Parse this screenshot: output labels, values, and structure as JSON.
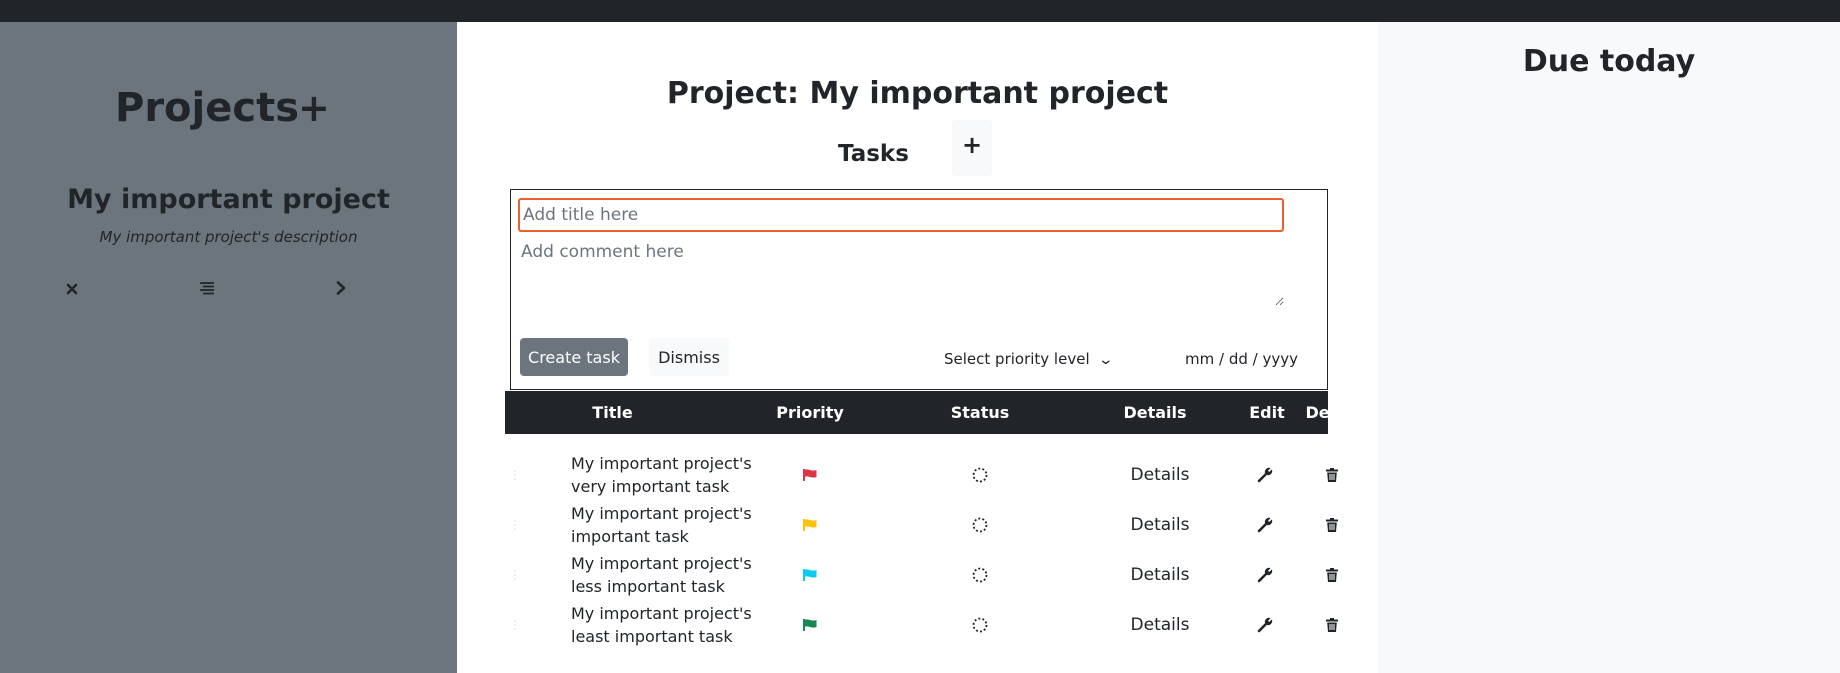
{
  "sidebar": {
    "title": "Projects",
    "add_label": "+",
    "project": {
      "name": "My important project",
      "description": "My important project's description"
    }
  },
  "main": {
    "title": "Project: My important project",
    "tasks_label": "Tasks",
    "tasks_add_label": "+",
    "form": {
      "title_placeholder": "Add title here",
      "comment_placeholder": "Add comment here",
      "create_label": "Create task",
      "dismiss_label": "Dismiss",
      "priority_placeholder": "Select priority level",
      "date_placeholder": "mm / dd / yyyy"
    },
    "table": {
      "headers": {
        "title": "Title",
        "priority": "Priority",
        "status": "Status",
        "details": "Details",
        "edit": "Edit",
        "delete": "Delete"
      },
      "rows": [
        {
          "title": "My important project's very important task",
          "priority_color": "#dc3545",
          "details": "Details"
        },
        {
          "title": "My important project's important task",
          "priority_color": "#ffc107",
          "details": "Details"
        },
        {
          "title": "My important project's less important task",
          "priority_color": "#0dcaf0",
          "details": "Details"
        },
        {
          "title": "My important project's least important task",
          "priority_color": "#198754",
          "details": "Details"
        }
      ]
    }
  },
  "right": {
    "title": "Due today"
  }
}
